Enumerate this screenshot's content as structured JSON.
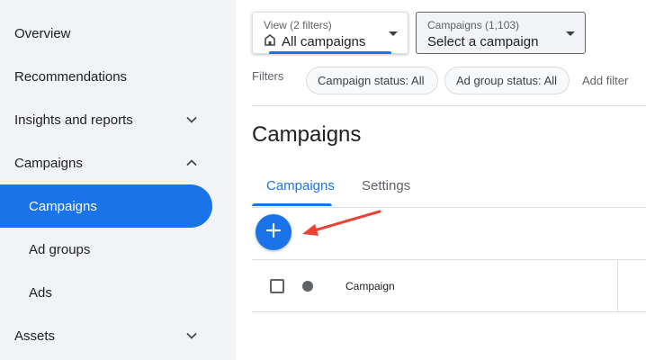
{
  "sidebar": {
    "items": [
      {
        "label": "Overview"
      },
      {
        "label": "Recommendations"
      },
      {
        "label": "Insights and reports"
      },
      {
        "label": "Campaigns"
      },
      {
        "label": "Campaigns"
      },
      {
        "label": "Ad groups"
      },
      {
        "label": "Ads"
      },
      {
        "label": "Assets"
      }
    ]
  },
  "toolbar": {
    "view": {
      "small": "View (2 filters)",
      "value": "All campaigns"
    },
    "campaigns": {
      "small": "Campaigns (1,103)",
      "value": "Select a campaign"
    }
  },
  "filters": {
    "label": "Filters",
    "chips": [
      "Campaign status: All",
      "Ad group status: All"
    ],
    "add_label": "Add filter"
  },
  "page": {
    "title": "Campaigns"
  },
  "tabs": [
    {
      "label": "Campaigns",
      "active": true
    },
    {
      "label": "Settings",
      "active": false
    }
  ],
  "table": {
    "columns": [
      "Campaign"
    ]
  },
  "colors": {
    "accent": "#1a73e8",
    "annotation_arrow": "#ea4335",
    "sidebar_bg": "#f1f3f4"
  },
  "icons": [
    "chevron-down-icon",
    "chevron-up-icon",
    "home-icon",
    "plus-icon",
    "annotation-arrow"
  ]
}
